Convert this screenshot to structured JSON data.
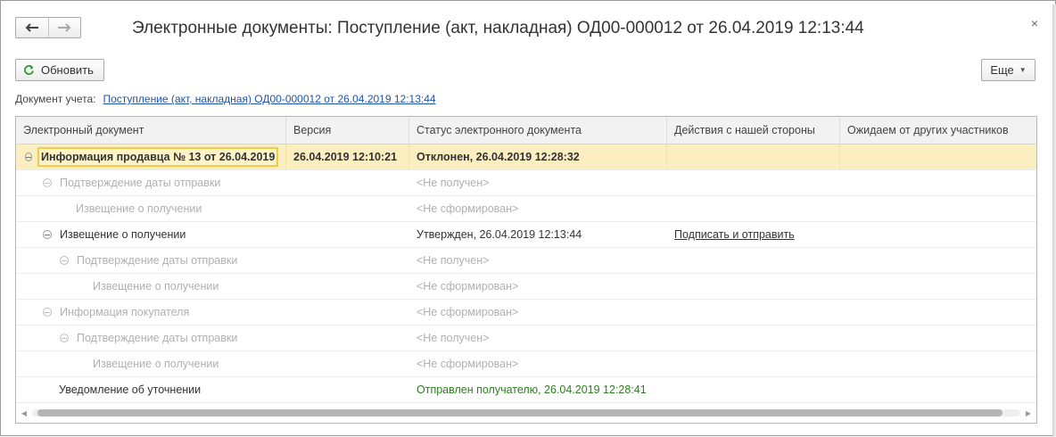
{
  "window": {
    "title": "Электронные документы: Поступление (акт, накладная) ОД00-000012 от 26.04.2019 12:13:44",
    "close_glyph": "×"
  },
  "toolbar": {
    "refresh_label": "Обновить",
    "more_label": "Еще"
  },
  "document": {
    "label": "Документ учета:",
    "link": "Поступление (акт, накладная) ОД00-000012 от 26.04.2019 12:13:44"
  },
  "grid": {
    "columns": [
      "Электронный документ",
      "Версия",
      "Статус электронного документа",
      "Действия с нашей стороны",
      "Ожидаем от других участников"
    ],
    "rows": [
      {
        "doc": "Информация продавца № 13 от 26.04.2019",
        "version": "26.04.2019 12:10:21",
        "status": "Отклонен, 26.04.2019 12:28:32",
        "action": "",
        "expect": ""
      },
      {
        "doc": "Подтверждение даты отправки",
        "version": "",
        "status": "<Не получен>",
        "action": "",
        "expect": ""
      },
      {
        "doc": "Извещение о получении",
        "version": "",
        "status": "<Не сформирован>",
        "action": "",
        "expect": ""
      },
      {
        "doc": "Извещение о получении",
        "version": "",
        "status": "Утвержден, 26.04.2019 12:13:44",
        "action": "Подписать и отправить",
        "expect": ""
      },
      {
        "doc": "Подтверждение даты отправки",
        "version": "",
        "status": "<Не получен>",
        "action": "",
        "expect": ""
      },
      {
        "doc": "Извещение о получении",
        "version": "",
        "status": "<Не сформирован>",
        "action": "",
        "expect": ""
      },
      {
        "doc": "Информация покупателя",
        "version": "",
        "status": "<Не сформирован>",
        "action": "",
        "expect": ""
      },
      {
        "doc": "Подтверждение даты отправки",
        "version": "",
        "status": "<Не получен>",
        "action": "",
        "expect": ""
      },
      {
        "doc": "Извещение о получении",
        "version": "",
        "status": "<Не сформирован>",
        "action": "",
        "expect": ""
      },
      {
        "doc": "Уведомление об уточнении",
        "version": "",
        "status": "Отправлен получателю, 26.04.2019 12:28:41",
        "action": "",
        "expect": ""
      }
    ]
  },
  "colors": {
    "selected_row": "#fbeec0",
    "link": "#1e54a8",
    "status_sent": "#2e7d20",
    "refresh_icon": "#2e9d2e"
  },
  "icons": {
    "back": "arrow-left-icon",
    "forward": "arrow-right-icon",
    "close": "close-icon",
    "refresh": "refresh-icon",
    "dropdown": "caret-down-icon",
    "tree_toggle": "collapse-icon"
  }
}
